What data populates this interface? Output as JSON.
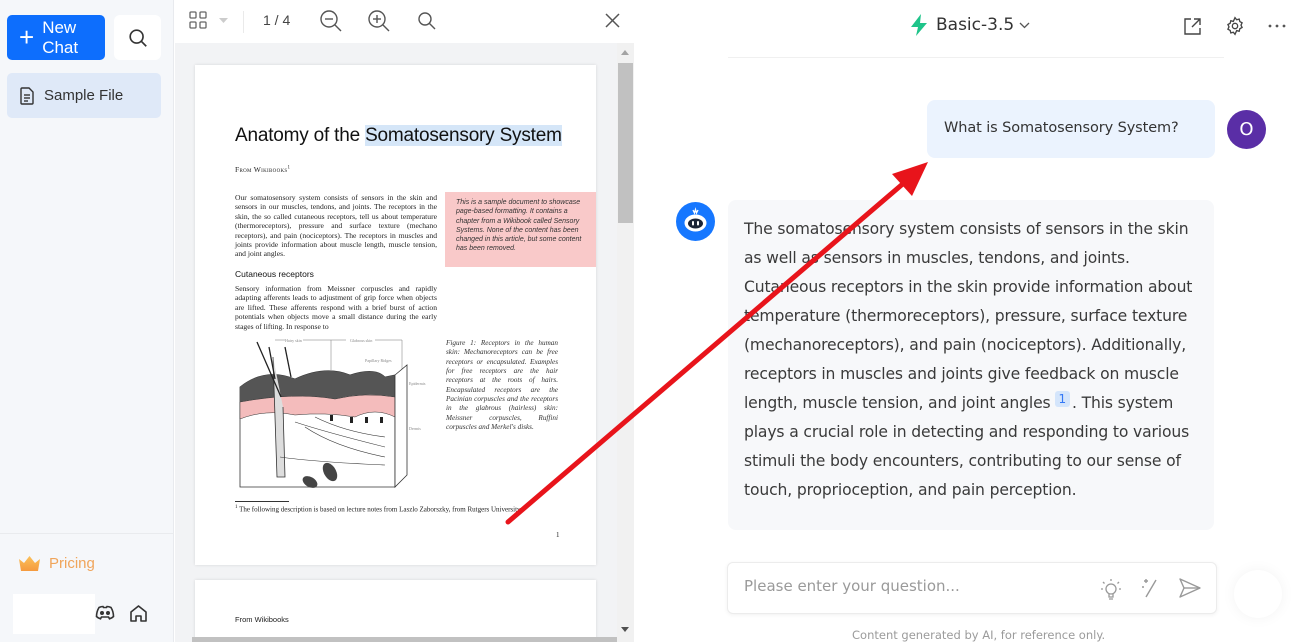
{
  "sidebar": {
    "new_chat_label": "New Chat",
    "new_chat_icon": "plus-icon",
    "search_icon": "search-icon",
    "files": [
      {
        "label": "Sample File",
        "icon": "document-icon"
      }
    ],
    "pricing_label": "Pricing",
    "pricing_icon": "crown-icon",
    "footer_icons": [
      "discord-icon",
      "home-icon"
    ]
  },
  "pdf_viewer": {
    "page_indicator": "1 / 4",
    "toolbar_icons": [
      "thumbnails-icon",
      "dropdown-icon",
      "zoom-out-icon",
      "zoom-in-icon",
      "search-icon",
      "close-icon"
    ],
    "page1": {
      "title_pre": "Anatomy of the ",
      "title_highlight": "Somatosensory System",
      "from": "From Wikibooks",
      "from_sup": "1",
      "para1": "Our somatosensory system consists of sensors in the skin and sensors in our muscles, tendons, and joints. The receptors in the skin, the so called cutaneous receptors, tell us about temperature (thermoreceptors), pressure and surface texture (mechano receptors), and pain (nociceptors). The receptors in muscles and joints provide information about muscle length, muscle tension, and joint angles.",
      "callout": "This is a sample document to showcase page-based formatting. It contains a chapter from a Wikibook called Sensory Systems. None of the content has been changed in this article, but some content has been removed.",
      "heading": "Cutaneous receptors",
      "para2": "Sensory information from Meissner corpuscles and rapidly adapting afferents leads to adjustment of grip force when objects are lifted. These afferents respond with a brief burst of action potentials when objects move a small distance during the early stages of lifting. In response to",
      "figure_labels": {
        "hairy_skin": "Hairy skin",
        "glabrous_skin": "Glabrous skin",
        "papillary_ridges": "Papillary Ridges",
        "epidermis": "Epidermis",
        "dermis": "Dermis"
      },
      "figure_caption": "Figure 1: Receptors in the human skin: Mechanoreceptors can be free receptors or encapsulated. Examples for free receptors are the hair receptors at the roots of hairs. Encapsulated receptors are the Pacinian corpuscles and the receptors in the glabrous (hairless) skin: Meissner corpuscles, Ruffini corpuscles and Merkel's disks.",
      "footnote": "The following description is based on lecture notes from Laszlo Zaborszky, from Rutgers University.",
      "footnote_mark": "1",
      "page_number": "1"
    },
    "page2": {
      "from": "From Wikibooks"
    }
  },
  "chat": {
    "model_name": "Basic-3.5",
    "model_icon": "lightning-icon",
    "header_icons": [
      "open-external-icon",
      "settings-icon",
      "more-icon"
    ],
    "messages": [
      {
        "role": "user",
        "avatar_letter": "O",
        "text": "What is Somatosensory System?"
      },
      {
        "role": "assistant",
        "avatar_icon": "bot-icon",
        "text_before_cite": "The somatosensory system consists of sensors in the skin as well as sensors in muscles, tendons, and joints. Cutaneous receptors in the skin provide information about temperature (thermoreceptors), pressure, surface texture (mechanoreceptors), and pain (nociceptors). Additionally, receptors in muscles and joints give feedback on muscle length, muscle tension, and joint angles",
        "citation": "1",
        "text_after_cite": ". This system plays a crucial role in detecting and responding to various stimuli the body encounters, contributing to our sense of touch, proprioception, and pain perception."
      }
    ],
    "input": {
      "placeholder": "Please enter your question...",
      "value": "",
      "icons": [
        "lightbulb-icon",
        "magic-wand-icon",
        "send-icon"
      ]
    },
    "disclaimer": "Content generated by AI, for reference only."
  },
  "annotation": {
    "type": "arrow",
    "color": "#e8141b"
  },
  "colors": {
    "primary": "#0d6efd",
    "pricing": "#f0a55b",
    "user_bubble": "#ebf3fe",
    "user_avatar": "#5a2ea6",
    "model_icon": "#1fc48a",
    "highlight": "#d5e6f8",
    "callout_bg": "#f9c9c9"
  }
}
